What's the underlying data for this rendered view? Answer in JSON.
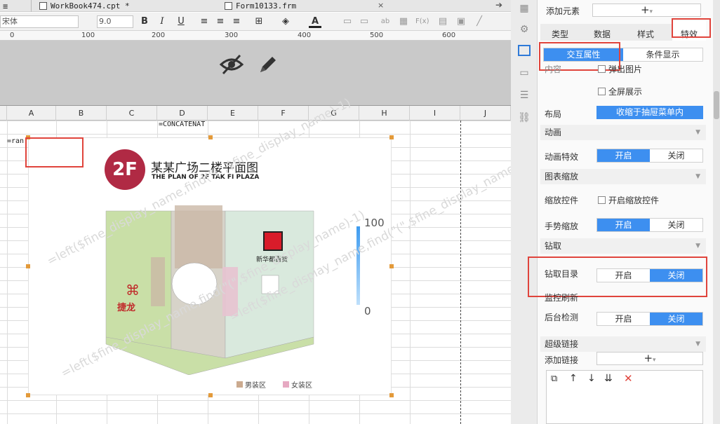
{
  "tabs": [
    {
      "label": "WorkBook474.cpt *"
    },
    {
      "label": "Form10133.frm"
    }
  ],
  "tab_close": "×",
  "toolbar": {
    "font_name": "宋体",
    "font_size": "9.0",
    "bold": "B",
    "italic": "I",
    "underline": "U",
    "font_color": "A"
  },
  "ruler": {
    "ticks": [
      "0",
      "100",
      "200",
      "300",
      "400",
      "500",
      "600"
    ]
  },
  "columns": [
    "A",
    "B",
    "C",
    "D",
    "E",
    "F",
    "G",
    "H",
    "I",
    "J"
  ],
  "cells": {
    "formula_top": "=CONCATENAT",
    "formula_a": "=ran"
  },
  "map": {
    "badge": "2F",
    "title_cn": "某某广场二楼平面图",
    "title_en": "THE PLAN OF 2F TAK FI PLAZA",
    "legend_max": "100",
    "legend_min": "0",
    "store_left": "捷龙",
    "store_right": "新华都百货",
    "legend_items": [
      "男装区",
      "女装区"
    ]
  },
  "watermark": "=left($fine_display_name,find(\"(\",$fine_display_name)-1)",
  "panel": {
    "add_element_label": "添加元素",
    "tabs": [
      "类型",
      "数据",
      "样式",
      "特效"
    ],
    "subtabs": [
      "交互属性",
      "条件显示"
    ],
    "content_label": "内容",
    "popup_img": "弹出图片",
    "fullscreen": "全屏展示",
    "layout_label": "布局",
    "layout_value": "收缩于抽屉菜单内",
    "sections": {
      "animation": "动画",
      "chart_zoom": "图表缩放",
      "drill": "钻取",
      "monitor": "监控刷新",
      "hyperlink": "超级链接"
    },
    "anim_label": "动画特效",
    "zoom_ctrl_label": "缩放控件",
    "zoom_ctrl_check": "开启缩放控件",
    "gesture_label": "手势缩放",
    "drill_dir_label": "钻取目录",
    "bg_check_label": "后台检测",
    "add_link_label": "添加链接",
    "on": "开启",
    "off": "关闭"
  },
  "colors": {
    "accent": "#3d8ff0",
    "highlight": "#e0443c"
  }
}
